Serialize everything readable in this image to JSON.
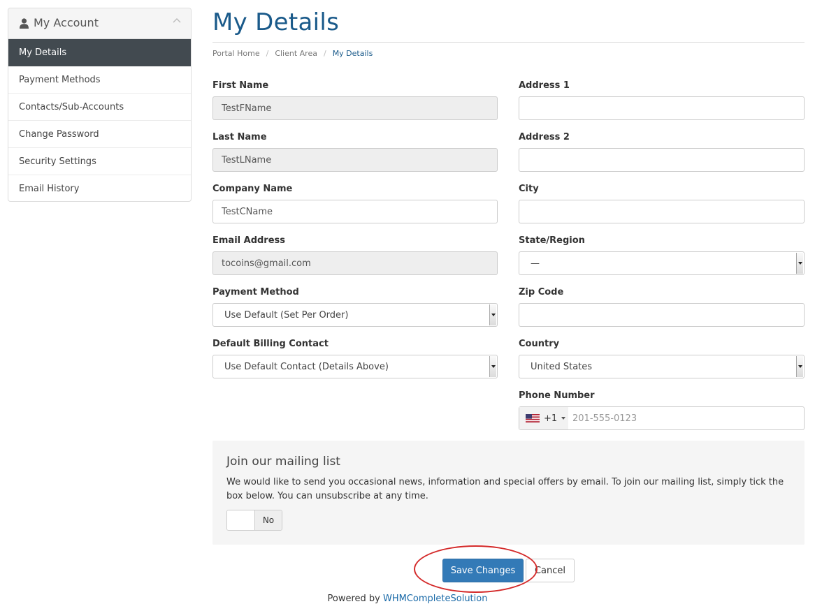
{
  "sidebar": {
    "title": "My Account",
    "items": [
      {
        "label": "My Details",
        "active": true
      },
      {
        "label": "Payment Methods"
      },
      {
        "label": "Contacts/Sub-Accounts"
      },
      {
        "label": "Change Password"
      },
      {
        "label": "Security Settings"
      },
      {
        "label": "Email History"
      }
    ]
  },
  "page": {
    "title": "My Details",
    "breadcrumb": [
      "Portal Home",
      "Client Area",
      "My Details"
    ]
  },
  "form": {
    "first_name": {
      "label": "First Name",
      "value": "TestFName"
    },
    "last_name": {
      "label": "Last Name",
      "value": "TestLName"
    },
    "company_name": {
      "label": "Company Name",
      "value": "TestCName"
    },
    "email": {
      "label": "Email Address",
      "value": "tocoins@gmail.com"
    },
    "payment_method": {
      "label": "Payment Method",
      "value": "Use Default (Set Per Order)"
    },
    "billing_contact": {
      "label": "Default Billing Contact",
      "value": "Use Default Contact (Details Above)"
    },
    "address1": {
      "label": "Address 1",
      "value": ""
    },
    "address2": {
      "label": "Address 2",
      "value": ""
    },
    "city": {
      "label": "City",
      "value": ""
    },
    "state": {
      "label": "State/Region",
      "value": "—"
    },
    "zip": {
      "label": "Zip Code",
      "value": ""
    },
    "country": {
      "label": "Country",
      "value": "United States"
    },
    "phone": {
      "label": "Phone Number",
      "country_code": "+1",
      "placeholder": "201-555-0123",
      "flag": "us-flag-icon"
    }
  },
  "mailing": {
    "title": "Join our mailing list",
    "text": "We would like to send you occasional news, information and special offers by email. To join our mailing list, simply tick the box below. You can unsubscribe at any time.",
    "toggle_label": "No"
  },
  "actions": {
    "save_label": "Save Changes",
    "cancel_label": "Cancel"
  },
  "footer": {
    "powered_prefix": "Powered by ",
    "powered_brand": "WHMCompleteSolution"
  },
  "colors": {
    "accent": "#337ab7",
    "title": "#1a5a8a",
    "sidebar_active": "#424a50",
    "highlight": "#d42a2a"
  }
}
